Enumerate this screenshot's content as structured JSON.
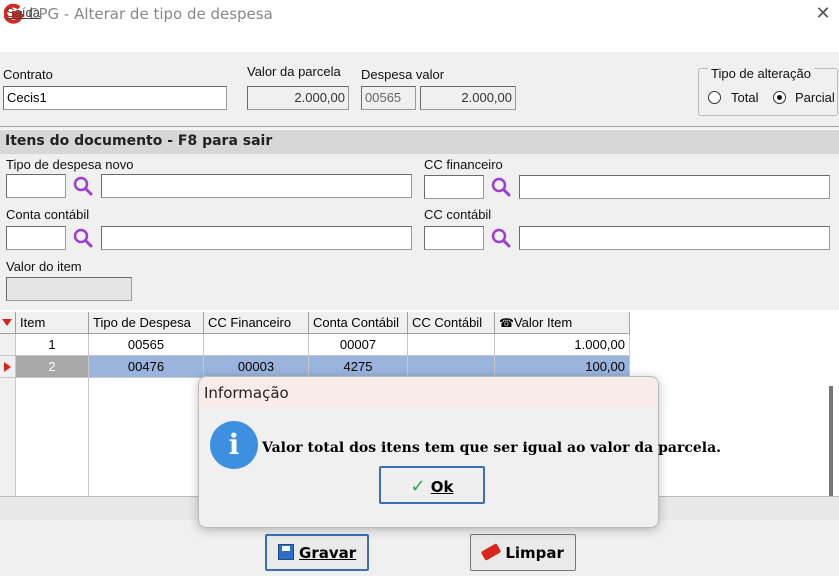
{
  "window": {
    "title": "CPG - Alterar de tipo de despesa"
  },
  "menu": {
    "saida": "Saída"
  },
  "form": {
    "contrato_label": "Contrato",
    "contrato_value": "Cecis1",
    "valor_parcela_label": "Valor da parcela",
    "valor_parcela_value": "2.000,00",
    "despesa_valor_label": "Despesa valor",
    "despesa_code": "00565",
    "despesa_amount": "2.000,00",
    "tipo_alteracao": {
      "label": "Tipo de alteração",
      "options": [
        "Total",
        "Parcial"
      ],
      "selected": "Parcial"
    }
  },
  "itens": {
    "title": "Itens do documento   - F8 para sair",
    "tipo_despesa_novo_label": "Tipo de despesa novo",
    "cc_financeiro_label": "CC financeiro",
    "conta_contabil_label": "Conta contábil",
    "cc_contabil_label": "CC contábil",
    "valor_item_label": "Valor do item"
  },
  "grid": {
    "headers": [
      "Item",
      "Tipo de Despesa",
      "CC Financeiro",
      "Conta Contábil",
      "CC Contábil",
      "Valor Item"
    ],
    "rows": [
      [
        "1",
        "00565",
        "",
        "00007",
        "",
        "1.000,00"
      ],
      [
        "2",
        "00476",
        "00003",
        "4275",
        "",
        "100,00"
      ]
    ]
  },
  "buttons": {
    "gravar": "Gravar",
    "limpar": "Limpar"
  },
  "dialog": {
    "title": "Informação",
    "message": "Valor total dos itens tem que ser igual ao valor da parcela.",
    "ok": "Ok"
  },
  "colors": {
    "accent_red": "#d9261c",
    "search_purple": "#9b3fd1",
    "selection": "#9ab4de",
    "info_blue": "#3d8fe0"
  }
}
